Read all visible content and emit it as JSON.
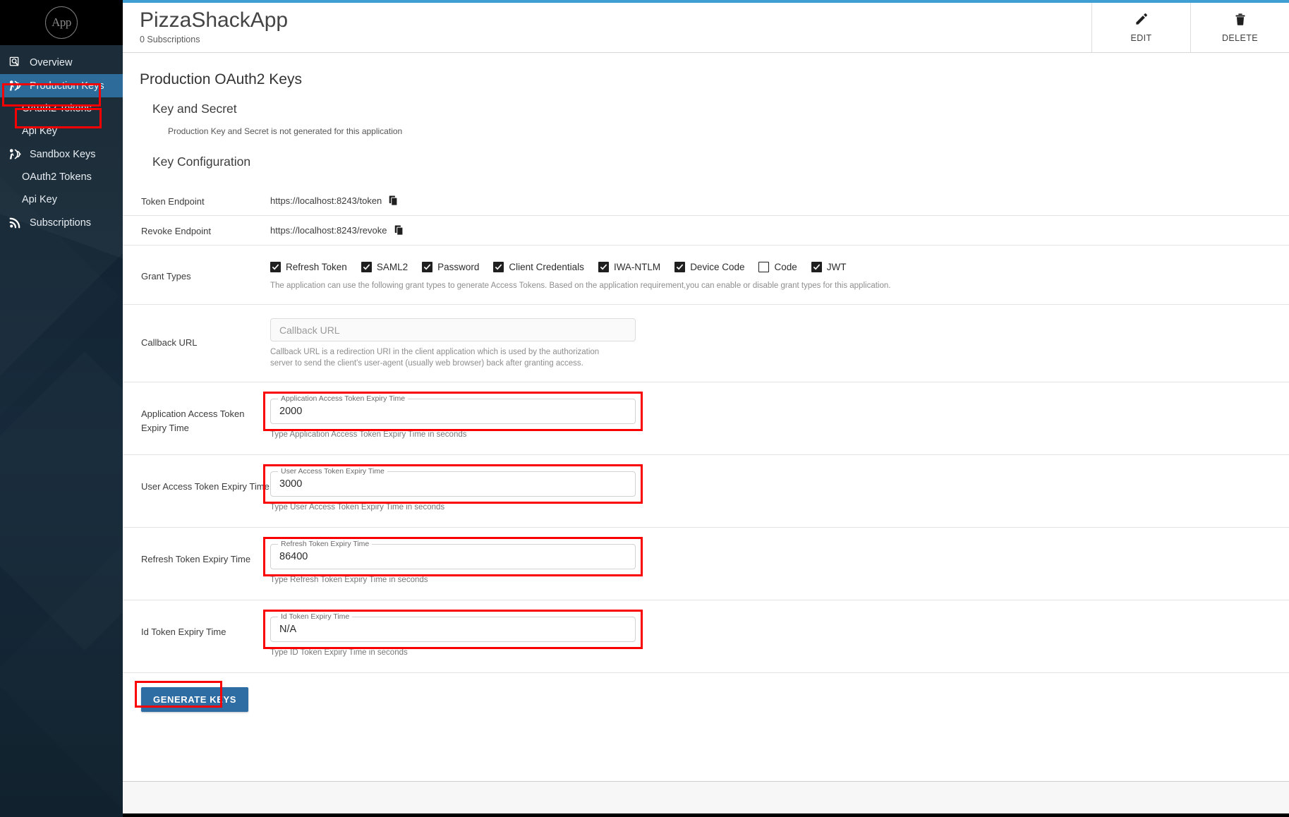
{
  "sidebar": {
    "logo_text": "App",
    "items": [
      {
        "label": "Overview",
        "icon": "overview-search-icon",
        "type": "main",
        "active": false
      },
      {
        "label": "Production Keys",
        "icon": "keys-icon",
        "type": "main",
        "active": true
      },
      {
        "label": "OAuth2 Tokens",
        "icon": "",
        "type": "sub",
        "active": false
      },
      {
        "label": "Api Key",
        "icon": "",
        "type": "sub",
        "active": false
      },
      {
        "label": "Sandbox Keys",
        "icon": "keys-icon",
        "type": "main",
        "active": false
      },
      {
        "label": "OAuth2 Tokens",
        "icon": "",
        "type": "sub",
        "active": false
      },
      {
        "label": "Api Key",
        "icon": "",
        "type": "sub",
        "active": false
      },
      {
        "label": "Subscriptions",
        "icon": "subscriptions-icon",
        "type": "main",
        "active": false
      }
    ]
  },
  "header": {
    "title": "PizzaShackApp",
    "subtitle": "0 Subscriptions",
    "edit_label": "EDIT",
    "delete_label": "DELETE"
  },
  "page": {
    "title": "Production OAuth2 Keys",
    "key_and_secret_heading": "Key and Secret",
    "key_and_secret_note": "Production Key and Secret is not generated for this application",
    "key_configuration_heading": "Key Configuration"
  },
  "endpoints": {
    "token_label": "Token Endpoint",
    "token_value": "https://localhost:8243/token",
    "revoke_label": "Revoke Endpoint",
    "revoke_value": "https://localhost:8243/revoke"
  },
  "grant_types": {
    "label": "Grant Types",
    "helper": "The application can use the following grant types to generate Access Tokens. Based on the application requirement,you can enable or disable grant types for this application.",
    "options": [
      {
        "label": "Refresh Token",
        "checked": true
      },
      {
        "label": "SAML2",
        "checked": true
      },
      {
        "label": "Password",
        "checked": true
      },
      {
        "label": "Client Credentials",
        "checked": true
      },
      {
        "label": "IWA-NTLM",
        "checked": true
      },
      {
        "label": "Device Code",
        "checked": true
      },
      {
        "label": "Code",
        "checked": false
      },
      {
        "label": "JWT",
        "checked": true
      }
    ]
  },
  "callback": {
    "label": "Callback URL",
    "placeholder": "Callback URL",
    "value": "",
    "helper": "Callback URL is a redirection URI in the client application which is used by the authorization server to send the client's user-agent (usually web browser) back after granting access."
  },
  "fields": [
    {
      "row_label": "Application Access Token Expiry Time",
      "legend": "Application Access Token Expiry Time",
      "value": "2000",
      "helper": "Type Application Access Token Expiry Time in seconds",
      "highlighted": true
    },
    {
      "row_label": "User Access Token Expiry Time",
      "legend": "User Access Token Expiry Time",
      "value": "3000",
      "helper": "Type User Access Token Expiry Time in seconds",
      "highlighted": true
    },
    {
      "row_label": "Refresh Token Expiry Time",
      "legend": "Refresh Token Expiry Time",
      "value": "86400",
      "helper": "Type Refresh Token Expiry Time in seconds",
      "highlighted": true
    },
    {
      "row_label": "Id Token Expiry Time",
      "legend": "Id Token Expiry Time",
      "value": "N/A",
      "helper": "Type ID Token Expiry Time in seconds",
      "highlighted": true
    }
  ],
  "actions": {
    "generate_keys_label": "GENERATE KEYS"
  },
  "colors": {
    "accent_blue": "#3f9fd4",
    "sidebar_bg": "#11222e",
    "active_nav": "#2d6b9b",
    "button_blue": "#2e6da4",
    "highlight_red": "#fb0000"
  }
}
